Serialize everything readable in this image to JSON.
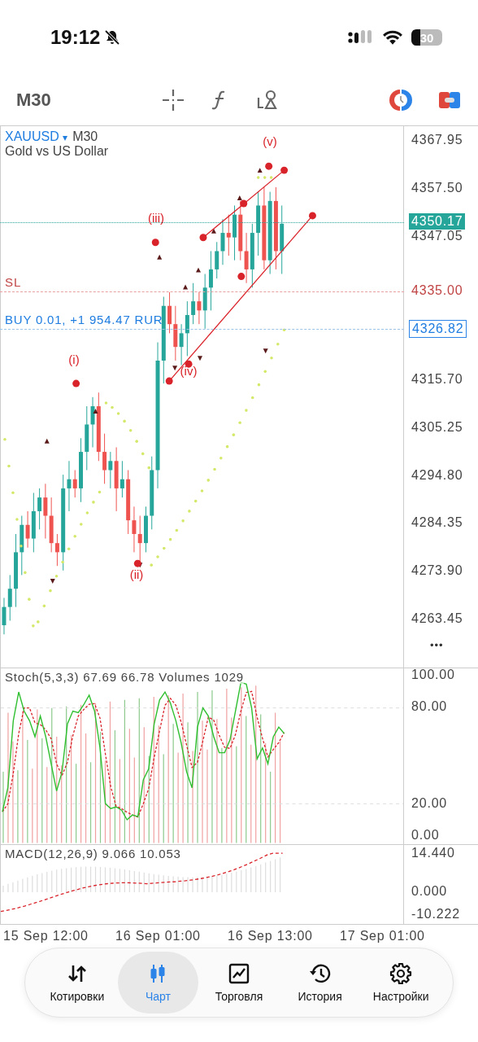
{
  "status_bar": {
    "time": "19:12",
    "battery": "30"
  },
  "toolbar": {
    "timeframe": "M30"
  },
  "chart": {
    "symbol": "XAUUSD",
    "symbol_caret": "▾",
    "timeframe": "M30",
    "description": "Gold vs US Dollar",
    "price_ticks": [
      "4367.95",
      "4357.50",
      "4347.05",
      "4315.70",
      "4305.25",
      "4294.80",
      "4284.35",
      "4273.90",
      "4263.45"
    ],
    "current_price": "4350.17",
    "stop_loss": {
      "label": "SL",
      "price": "4335.00"
    },
    "position": {
      "label": "BUY 0.01, +1 954.47 RUR",
      "price": "4326.82"
    },
    "wave_labels": [
      "(i)",
      "(ii)",
      "(iii)",
      "(iv)",
      "(v)"
    ],
    "more": "•••"
  },
  "stochastic": {
    "legend": "Stoch(5,3,3) 67.69 66.78 Volumes 1029",
    "ticks": [
      "100.00",
      "80.00",
      "20.00",
      "0.00"
    ]
  },
  "macd": {
    "legend": "MACD(12,26,9) 9.066 10.053",
    "ticks": [
      "14.440",
      "0.000",
      "-10.222"
    ]
  },
  "time_axis": [
    "15 Sep 12:00",
    "16 Sep 01:00",
    "16 Sep 13:00",
    "17 Sep 01:00"
  ],
  "nav": [
    {
      "label": "Котировки",
      "selected": false
    },
    {
      "label": "Чарт",
      "selected": true
    },
    {
      "label": "Торговля",
      "selected": false
    },
    {
      "label": "История",
      "selected": false
    },
    {
      "label": "Настройки",
      "selected": false
    }
  ]
}
